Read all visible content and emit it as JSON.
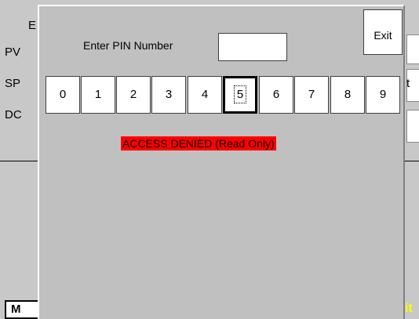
{
  "background": {
    "labels": [
      "E",
      "PV",
      "SP",
      "DC"
    ],
    "right_glyph": "t",
    "bottom_button_label": "M",
    "bottom_right_text": "it"
  },
  "dialog": {
    "prompt_label": "Enter PIN Number",
    "pin_value": "",
    "exit_label": "Exit",
    "keys": [
      "0",
      "1",
      "2",
      "3",
      "4",
      "5",
      "6",
      "7",
      "8",
      "9"
    ],
    "selected_key": "5",
    "status_message": "ACCESS DENIED (Read Only)",
    "colors": {
      "status_bg": "#ff0000",
      "dialog_bg": "#c0c0c0"
    }
  }
}
